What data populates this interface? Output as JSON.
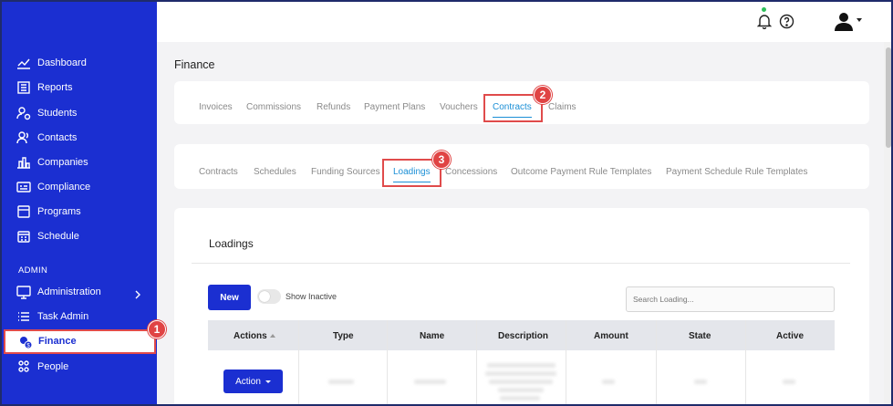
{
  "sidebar": {
    "items": [
      {
        "label": "Dashboard",
        "icon": "chart-line-icon"
      },
      {
        "label": "Reports",
        "icon": "report-icon"
      },
      {
        "label": "Students",
        "icon": "students-icon"
      },
      {
        "label": "Contacts",
        "icon": "contacts-icon"
      },
      {
        "label": "Companies",
        "icon": "companies-icon"
      },
      {
        "label": "Compliance",
        "icon": "compliance-icon"
      },
      {
        "label": "Programs",
        "icon": "programs-icon"
      },
      {
        "label": "Schedule",
        "icon": "calendar-icon"
      }
    ],
    "section_label": "ADMIN",
    "admin_items": [
      {
        "label": "Administration",
        "icon": "monitor-icon"
      },
      {
        "label": "Task Admin",
        "icon": "list-icon"
      },
      {
        "label": "Finance",
        "icon": "finance-icon",
        "active": true
      },
      {
        "label": "People",
        "icon": "people-icon"
      }
    ]
  },
  "badges": {
    "one": "1",
    "two": "2",
    "three": "3"
  },
  "page": {
    "title": "Finance"
  },
  "tabs_primary": [
    "Invoices",
    "Commissions",
    "Refunds",
    "Payment Plans",
    "Vouchers",
    "Contracts",
    "Claims"
  ],
  "tabs_primary_active": "Contracts",
  "tabs_secondary": [
    "Contracts",
    "Schedules",
    "Funding Sources",
    "Loadings",
    "Concessions",
    "Outcome Payment Rule Templates",
    "Payment Schedule Rule Templates"
  ],
  "tabs_secondary_active": "Loadings",
  "loadings": {
    "title": "Loadings",
    "new_label": "New",
    "show_inactive_label": "Show Inactive",
    "search_placeholder": "Search Loading...",
    "columns": [
      "Actions",
      "Type",
      "Name",
      "Description",
      "Amount",
      "State",
      "Active"
    ],
    "row_action_label": "Action"
  },
  "colors": {
    "accent": "#1b2fd1",
    "highlight": "#e04b4b",
    "tab_active": "#1b8fd6"
  }
}
